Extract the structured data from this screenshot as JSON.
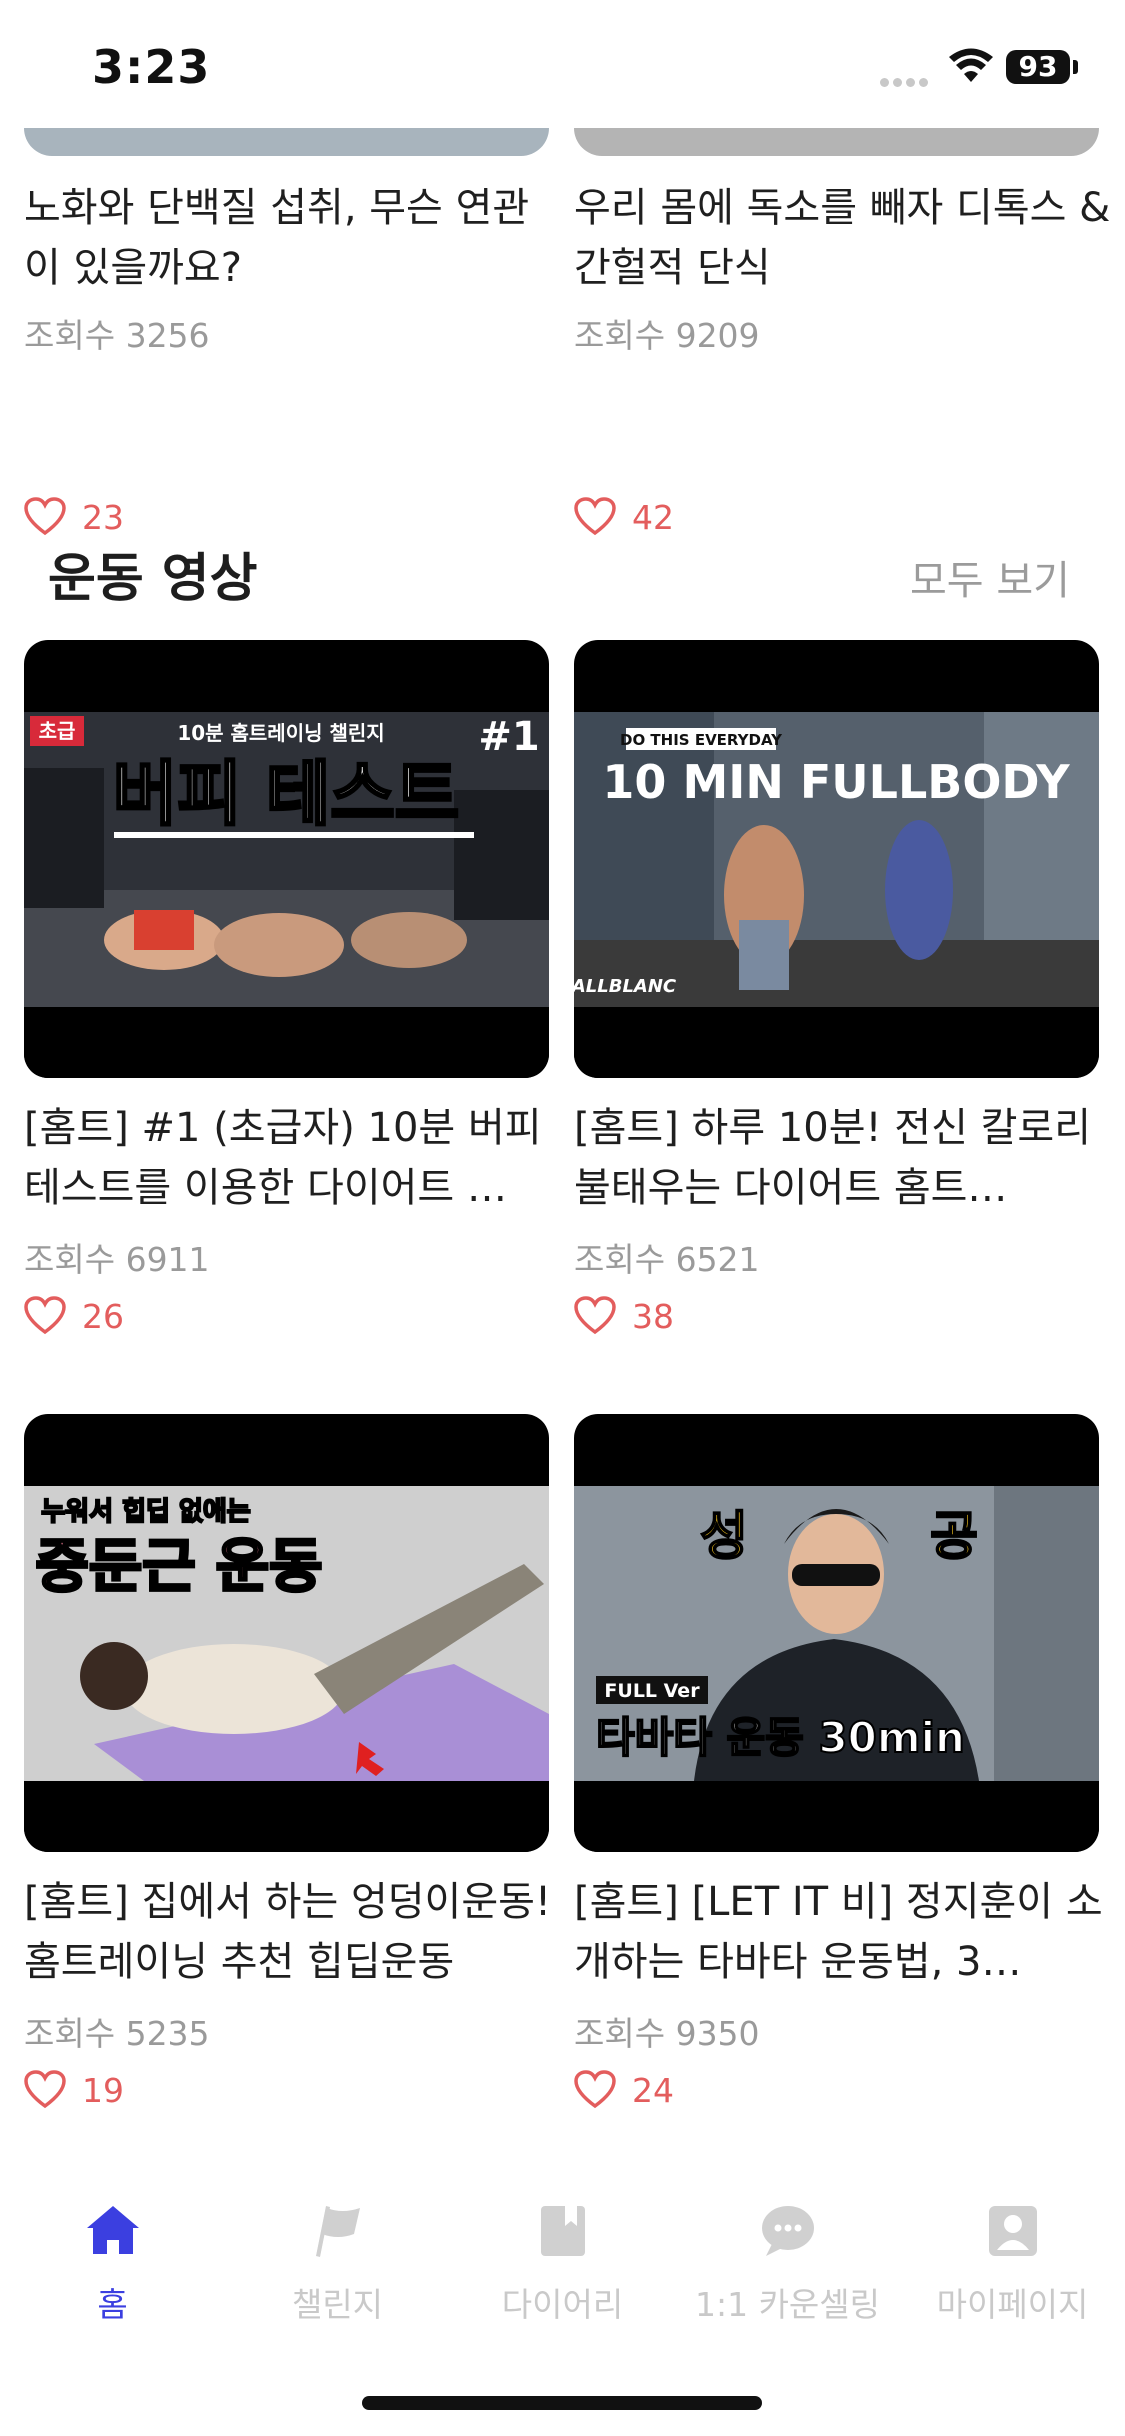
{
  "status": {
    "time": "3:23",
    "battery": "93"
  },
  "top_cards": [
    {
      "title": "노화와 단백질 섭취, 무슨 연관이 있을까요?",
      "views": "조회수 3256",
      "likes": "23"
    },
    {
      "title": "우리 몸에 독소를 빼자 디톡스 & 간헐적 단식",
      "views": "조회수 9209",
      "likes": "42"
    }
  ],
  "section": {
    "title": "운동 영상",
    "see_all": "모두 보기"
  },
  "videos": [
    {
      "title": "[홈트] #1 (초급자) 10분 버피 테스트를 이용한 다이어트 …",
      "views": "조회수 6911",
      "likes": "26",
      "thumb": {
        "badge": "초급",
        "sub": "10분 홈트레이닝 챌린지",
        "main": "버피 테스트",
        "num": "#1"
      }
    },
    {
      "title": "[홈트] 하루 10분! 전신 칼로리 불태우는 다이어트 홈트…",
      "views": "조회수 6521",
      "likes": "38",
      "thumb": {
        "tag": "DO THIS EVERYDAY",
        "main": "10 MIN FULLBODY",
        "brand": "ALLBLANC"
      }
    },
    {
      "title": "[홈트] 집에서 하는 엉덩이운동! 홈트레이닝 추천 힙딥운동",
      "views": "조회수 5235",
      "likes": "19",
      "thumb": {
        "sub": "누워서 힙딥 없애는",
        "main": "중둔근 운동"
      }
    },
    {
      "title": "[홈트] [LET IT 비] 정지훈이 소개하는 타바타 운동법, 3…",
      "views": "조회수 9350",
      "likes": "24",
      "thumb": {
        "left": "성",
        "right": "공",
        "tag": "FULL Ver",
        "main": "타바타 운동 30min"
      }
    }
  ],
  "tabs": [
    {
      "label": "홈",
      "icon": "home-icon",
      "active": true
    },
    {
      "label": "챌린지",
      "icon": "flag-icon",
      "active": false
    },
    {
      "label": "다이어리",
      "icon": "diary-icon",
      "active": false
    },
    {
      "label": "1:1 카운셀링",
      "icon": "chat-icon",
      "active": false
    },
    {
      "label": "마이페이지",
      "icon": "profile-icon",
      "active": false
    }
  ],
  "colors": {
    "accent": "#3b3fe0",
    "like": "#e35d5d",
    "muted": "#9a9a9a",
    "tab_inactive": "#c9c9c9"
  }
}
